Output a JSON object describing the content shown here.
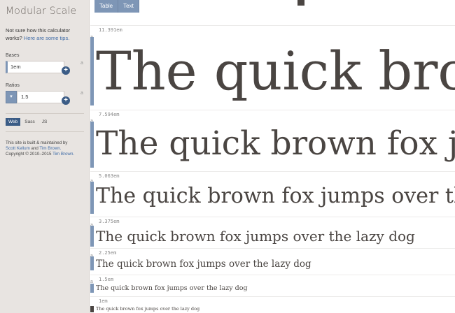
{
  "sidebar": {
    "title": "Modular Scale",
    "help_text": "Not sure how this calculator works? ",
    "help_link": "Here are some tips.",
    "bases_label": "Bases",
    "bases_value": "1em",
    "ratios_label": "Ratios",
    "ratio_value": "1.5",
    "ratio_select": "▾",
    "side_marker": "a",
    "tabs": [
      "Web",
      "Sass",
      "JS"
    ],
    "credits_line": "This site is built & maintained by",
    "credit_author_1": "Scott Kellum",
    "credit_and": " and ",
    "credit_author_2": "Tim Brown.",
    "copyright": "Copyright © 2010–2015 ",
    "copyright_link": "Tim Brown."
  },
  "top_tabs": [
    "Table",
    "Text"
  ],
  "scale": {
    "row_marker": "a",
    "rows": [
      {
        "em": "11.391em",
        "sample": "The quick brown fox jumps over the lazy dog"
      },
      {
        "em": "7.594em",
        "sample": "The quick brown fox jumps over the lazy dog"
      },
      {
        "em": "5.063em",
        "sample": "The quick brown fox jumps over the lazy dog"
      },
      {
        "em": "3.375em",
        "sample": "The quick brown fox jumps over the lazy dog"
      },
      {
        "em": "2.25em",
        "sample": "The quick brown fox jumps over the lazy dog"
      },
      {
        "em": "1.5em",
        "sample": "The quick brown fox jumps over the lazy dog"
      },
      {
        "em": "1em",
        "sample": "The quick brown fox jumps over the lazy dog"
      }
    ]
  },
  "colors": {
    "accent": "#7e96b6",
    "accent_dark": "#3b5c86",
    "sidebar_bg": "#e8e4e1",
    "text_serif": "#4a4542"
  }
}
